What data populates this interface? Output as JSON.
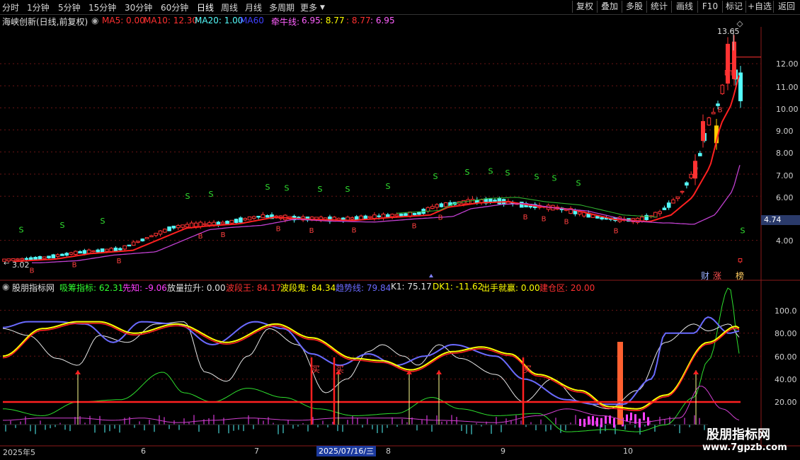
{
  "toolbar": {
    "periods": [
      "分时",
      "1分钟",
      "5分钟",
      "15分钟",
      "30分钟",
      "60分钟",
      "日线",
      "周线",
      "月线",
      "多周期",
      "更多"
    ],
    "active_period": "日线",
    "tools": [
      "复权",
      "叠加",
      "多股",
      "统计",
      "画线",
      "F10",
      "标记",
      "+自选",
      "返回"
    ]
  },
  "header": {
    "title": "海峡创新(日线,前复权)",
    "ma5": "MA5: 0.00",
    "ma10": "MA10: 12.30",
    "ma20": "MA20: 1.00",
    "ma60": "MA60",
    "qianniu_label": "牵牛线:",
    "qianniu_v1": "6.95",
    "qianniu_v2": ": 8.77",
    "qianniu_v3": ": 8.77",
    "qianniu_v4": ": 6.95"
  },
  "price_axis": [
    "12.00",
    "11.00",
    "10.00",
    "9.00",
    "8.00",
    "7.00",
    "6.00",
    "5.00",
    "4.00"
  ],
  "current_price": "4.74",
  "max_label": "13.65",
  "min_label": "3.02",
  "signal_b": "B",
  "signal_s": "S",
  "badges": {
    "cai": "财",
    "zhang": "涨",
    "bang": "榜"
  },
  "indicator_bar": {
    "name": "股朋指标网",
    "xichou": "吸筹指标: 62.31",
    "xianzhi": "先知: -9.06",
    "fangliang": "放量拉升: 0.00",
    "boduanwang": "波段王: 84.17",
    "boduangui": "波段鬼: 84.34",
    "qushixian": "趋势线: 79.84",
    "k1": "K1: 75.17",
    "dk1": "DK1: -11.62",
    "chushou": "出手就赢: 0.00",
    "jiancang": "建仓区: 20.00"
  },
  "indicator_axis": [
    "100.0",
    "80.00",
    "60.00",
    "40.00",
    "20.00"
  ],
  "buy_marks": [
    "买",
    "买",
    "买"
  ],
  "xaxis": {
    "labels": [
      "2025年5",
      "6",
      "7",
      "8",
      "9",
      "10"
    ],
    "highlight": "2025/07/16/三"
  },
  "watermark": {
    "line1": "股朋指标网",
    "line2": "www.7gpzb.com"
  },
  "colors": {
    "up": "#ff3232",
    "down": "#54fcfc",
    "ma_red": "#ff2020",
    "ma_magenta": "#d040d0",
    "ma_green": "#30c030",
    "yellow": "#ffff00",
    "blue": "#6a6aff",
    "white": "#e0e0e0"
  }
}
